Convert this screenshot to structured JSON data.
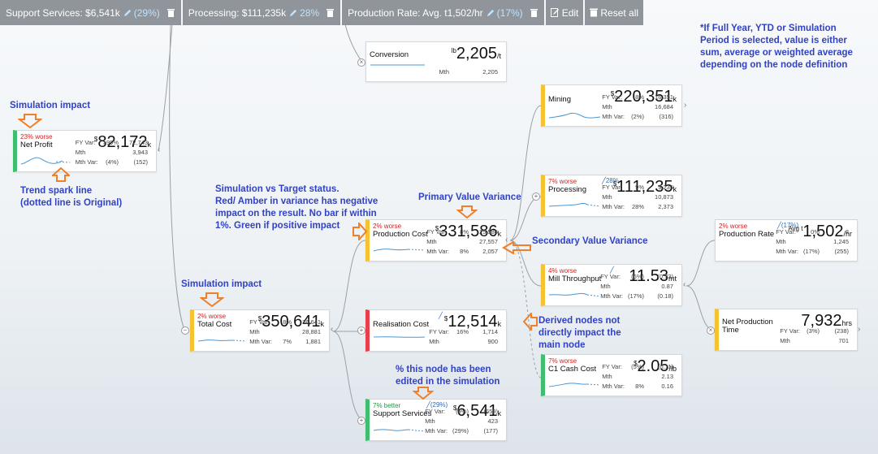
{
  "toolbar": {
    "support": {
      "label": "Support Services: $6,541k",
      "pct": "(29%)"
    },
    "processing": {
      "label": "Processing: $111,235k",
      "pct": "28%"
    },
    "production": {
      "label": "Production Rate: Avg. t1,502/hr",
      "pct": "(17%)"
    },
    "edit_label": "Edit",
    "reset_label": "Reset all"
  },
  "nodes": {
    "net_profit": {
      "status": "23% worse",
      "name": "Net Profit",
      "cur": "$",
      "value": "82,172",
      "unit": "k",
      "rows": [
        [
          "FY Var:",
          ">99%",
          "72,743"
        ],
        [
          "Mth",
          "",
          "3,943"
        ],
        [
          "Mth Var:",
          "(4%)",
          "(152)"
        ]
      ]
    },
    "total_cost": {
      "status": "2% worse",
      "name": "Total Cost",
      "cur": "$",
      "value": "350,641",
      "unit": "k",
      "rows": [
        [
          "FY Var:",
          "8%",
          "26,641"
        ],
        [
          "Mth",
          "",
          "28,881"
        ],
        [
          "Mth Var:",
          "7%",
          "1,881"
        ]
      ]
    },
    "conversion": {
      "name": "Conversion",
      "cur": "lb",
      "value": "2,205",
      "unit": "/t",
      "rows": [
        [
          "Mth",
          "",
          "2,205"
        ]
      ]
    },
    "production_cost": {
      "status": "2% worse",
      "name": "Production Cost",
      "cur": "$",
      "value": "331,586",
      "unit": "k",
      "rows": [
        [
          "FY Var:",
          "8%",
          "25,586"
        ],
        [
          "Mth",
          "",
          "27,557"
        ],
        [
          "Mth Var:",
          "8%",
          "2,057"
        ]
      ]
    },
    "realisation_cost": {
      "name": "Realisation Cost",
      "cur": "$",
      "value": "12,514",
      "unit": "k",
      "rows": [
        [
          "FY Var:",
          "16%",
          "1,714"
        ],
        [
          "Mth",
          "",
          "900"
        ]
      ]
    },
    "support_services": {
      "status": "7% better",
      "name": "Support Services",
      "cur": "$",
      "value": "6,541",
      "unit": "k",
      "edit": "(29%)",
      "rows": [
        [
          "FY Var:",
          "(9%)",
          "(659)"
        ],
        [
          "Mth",
          "",
          "423"
        ],
        [
          "Mth Var:",
          "(29%)",
          "(177)"
        ]
      ]
    },
    "mining": {
      "name": "Mining",
      "cur": "$",
      "value": "220,351",
      "unit": "k",
      "rows": [
        [
          "FY Var:",
          "8%",
          "16,351"
        ],
        [
          "Mth",
          "",
          "16,684"
        ],
        [
          "Mth Var:",
          "(2%)",
          "(316)"
        ]
      ]
    },
    "processing": {
      "status": "7% worse",
      "name": "Processing",
      "cur": "$",
      "value": "111,235",
      "unit": "k",
      "edit": "28%",
      "rows": [
        [
          "FY Var:",
          "9%",
          "9,235"
        ],
        [
          "Mth",
          "",
          "10,873"
        ],
        [
          "Mth Var:",
          "28%",
          "2,373"
        ]
      ]
    },
    "mill_throughput": {
      "status": "4% worse",
      "name": "Mill Throughput",
      "cur": "",
      "value": "11.53",
      "unit": "mt",
      "rows": [
        [
          "FY Var:",
          "(6%)",
          "(0.73)"
        ],
        [
          "Mth",
          "",
          "0.87"
        ],
        [
          "Mth Var:",
          "(17%)",
          "(0.18)"
        ]
      ]
    },
    "c1_cash_cost": {
      "status": "7% worse",
      "name": "C1 Cash Cost",
      "cur": "$",
      "value": "2.05",
      "unit": "/lb",
      "rows": [
        [
          "FY Var:",
          "(5%)",
          "(0.11)"
        ],
        [
          "Mth",
          "",
          "2.13"
        ],
        [
          "Mth Var:",
          "8%",
          "0.16"
        ]
      ]
    },
    "production_rate": {
      "status": "2% worse",
      "name": "Production Rate",
      "cur": "Avg t",
      "value": "1,502",
      "unit": "/hr",
      "edit": "(17%)",
      "rows": [
        [
          "FY Var:",
          "0%",
          "2"
        ],
        [
          "Mth",
          "",
          "1,245"
        ],
        [
          "Mth Var:",
          "(17%)",
          "(255)"
        ]
      ]
    },
    "net_production_time": {
      "name": "Net Production Time",
      "cur": "",
      "value": "7,932",
      "unit": "hrs",
      "rows": [
        [
          "FY Var:",
          "(3%)",
          "(238)"
        ],
        [
          "Mth",
          "",
          "701"
        ]
      ]
    }
  },
  "annotations": {
    "simulation_impact_1": "Simulation impact",
    "trend_spark": "Trend spark line\n(dotted line is Original)",
    "sim_vs_target": "Simulation vs Target status.\nRed/ Amber in variance has negative\nimpact on the result. No bar if within\n1%. Green if positive impact",
    "simulation_impact_2": "Simulation impact",
    "primary_variance": "Primary Value Variance",
    "secondary_variance": "Secondary Value Variance",
    "derived_nodes": "Derived nodes not\ndirectly impact the\nmain node",
    "pct_edited": "% this node has been\nedited in the simulation",
    "note": "*If Full Year, YTD or Simulation\nPeriod is selected, value is either\nsum, average or weighted average\ndepending on the node definition"
  },
  "colors": {
    "green": "#3fbf6e",
    "amber": "#f5c232",
    "red": "#e6404a",
    "annotation": "#3142c4",
    "arrow": "#f07f2a",
    "spark": "#4a97d2"
  }
}
